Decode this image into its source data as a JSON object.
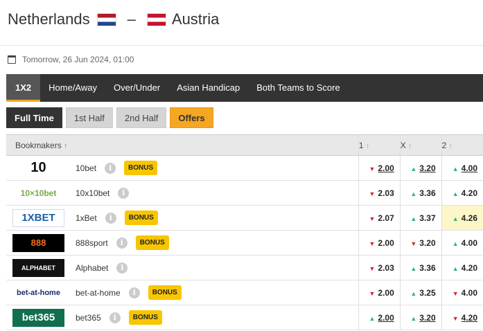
{
  "match": {
    "home": "Netherlands",
    "dash": "–",
    "away": "Austria",
    "datetime": "Tomorrow, 26 Jun 2024, 01:00"
  },
  "tabs": [
    {
      "label": "1X2"
    },
    {
      "label": "Home/Away"
    },
    {
      "label": "Over/Under"
    },
    {
      "label": "Asian Handicap"
    },
    {
      "label": "Both Teams to Score"
    }
  ],
  "subtabs": [
    {
      "label": "Full Time"
    },
    {
      "label": "1st Half"
    },
    {
      "label": "2nd Half"
    },
    {
      "label": "Offers"
    }
  ],
  "table": {
    "header_bookmakers": "Bookmakers",
    "header_1": "1",
    "header_x": "X",
    "header_2": "2",
    "bonus_label": "BONUS",
    "info_glyph": "i",
    "rows": [
      {
        "name": "10bet",
        "logo": "10",
        "bonus": true,
        "odds": [
          {
            "v": "2.00",
            "dir": "down",
            "ul": true
          },
          {
            "v": "3.20",
            "dir": "up",
            "ul": true
          },
          {
            "v": "4.00",
            "dir": "up",
            "ul": true
          }
        ]
      },
      {
        "name": "10x10bet",
        "logo": "10×10bet",
        "bonus": false,
        "odds": [
          {
            "v": "2.03",
            "dir": "down",
            "ul": false
          },
          {
            "v": "3.36",
            "dir": "up",
            "ul": false
          },
          {
            "v": "4.20",
            "dir": "up",
            "ul": false
          }
        ]
      },
      {
        "name": "1xBet",
        "logo": "1XBET",
        "bonus": true,
        "odds": [
          {
            "v": "2.07",
            "dir": "down",
            "ul": false
          },
          {
            "v": "3.37",
            "dir": "up",
            "ul": false
          },
          {
            "v": "4.26",
            "dir": "up",
            "ul": false
          }
        ]
      },
      {
        "name": "888sport",
        "logo": "888",
        "bonus": true,
        "odds": [
          {
            "v": "2.00",
            "dir": "down",
            "ul": false
          },
          {
            "v": "3.20",
            "dir": "down",
            "ul": false
          },
          {
            "v": "4.00",
            "dir": "up",
            "ul": false
          }
        ]
      },
      {
        "name": "Alphabet",
        "logo": "ALPHABET",
        "bonus": false,
        "odds": [
          {
            "v": "2.03",
            "dir": "down",
            "ul": false
          },
          {
            "v": "3.36",
            "dir": "up",
            "ul": false
          },
          {
            "v": "4.20",
            "dir": "up",
            "ul": false
          }
        ]
      },
      {
        "name": "bet-at-home",
        "logo": "bet-at-home",
        "bonus": true,
        "odds": [
          {
            "v": "2.00",
            "dir": "down",
            "ul": false
          },
          {
            "v": "3.25",
            "dir": "up",
            "ul": false
          },
          {
            "v": "4.00",
            "dir": "down",
            "ul": false
          }
        ]
      },
      {
        "name": "bet365",
        "logo": "bet365",
        "bonus": true,
        "odds": [
          {
            "v": "2.00",
            "dir": "up",
            "ul": true
          },
          {
            "v": "3.20",
            "dir": "up",
            "ul": true
          },
          {
            "v": "4.20",
            "dir": "down",
            "ul": true
          }
        ]
      }
    ]
  },
  "colors": {
    "accent": "#f5a623",
    "bonus": "#f7c600",
    "down": "#d9232d",
    "up": "#2bb673",
    "best_odds_bg": "#fdf6c8"
  },
  "icons": {
    "calendar": "calendar-icon",
    "info": "info-icon",
    "sort_up": "sort-up-arrow-icon",
    "odds_up": "triangle-up-icon",
    "odds_down": "triangle-down-icon"
  }
}
